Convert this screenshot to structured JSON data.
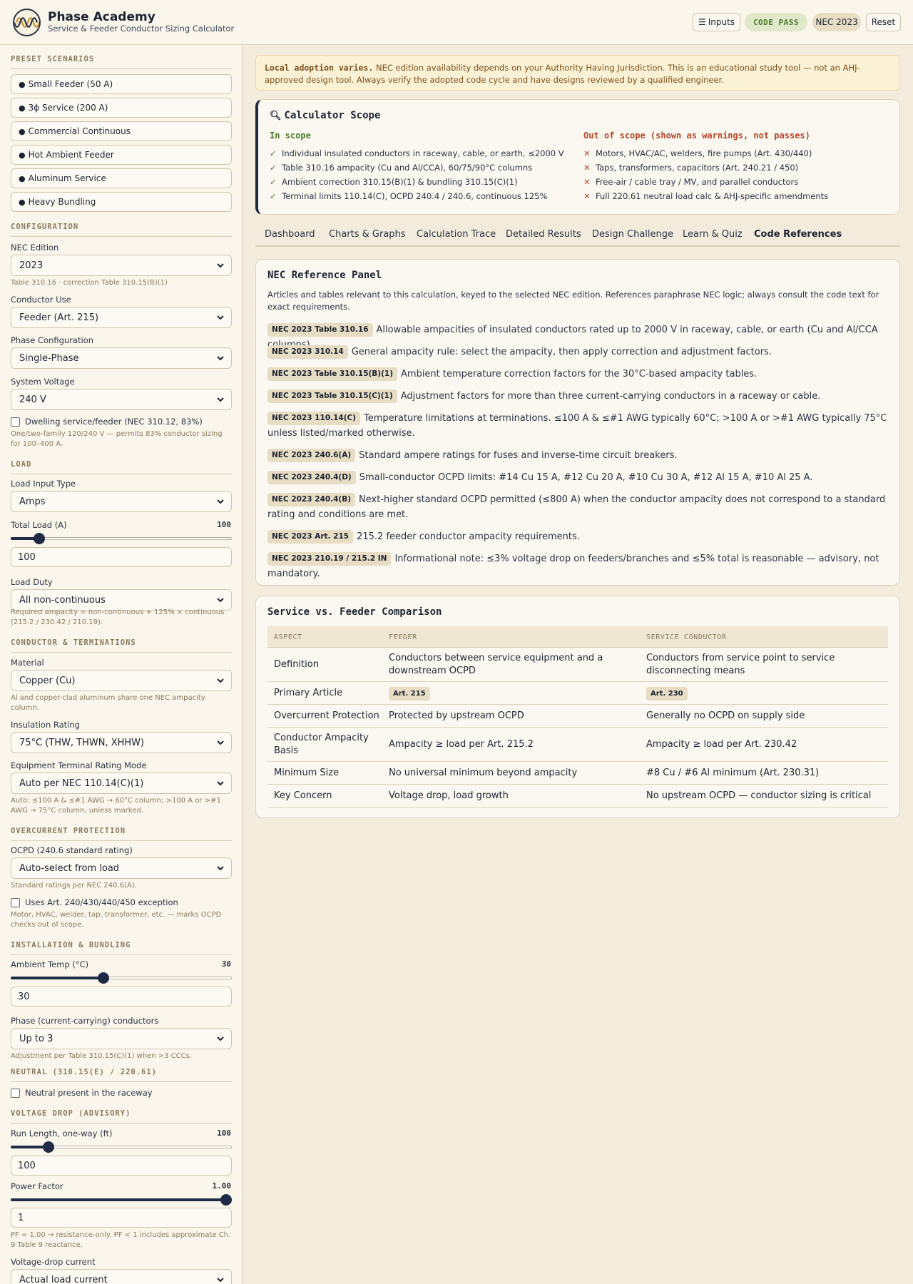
{
  "header": {
    "brand_title": "Phase Academy",
    "brand_subtitle": "Service & Feeder Conductor Sizing Calculator",
    "inputs_button": "Inputs",
    "status_pill": "CODE PASS",
    "edition_pill": "NEC 2023",
    "reset_button": "Reset"
  },
  "sidebar": {
    "presets_title": "PRESET SCENARIOS",
    "presets": [
      "Small Feeder (50 A)",
      "3ϕ Service (200 A)",
      "Commercial Continuous",
      "Hot Ambient Feeder",
      "Aluminum Service",
      "Heavy Bundling"
    ],
    "configuration": {
      "title": "CONFIGURATION",
      "nec_edition_label": "NEC Edition",
      "nec_edition_value": "2023",
      "nec_edition_hint": "Table 310.16 · correction Table 310.15(B)(1)",
      "conductor_use_label": "Conductor Use",
      "conductor_use_value": "Feeder (Art. 215)",
      "phase_label": "Phase Configuration",
      "phase_value": "Single-Phase",
      "voltage_label": "System Voltage",
      "voltage_value": "240 V",
      "dwelling_label": "Dwelling service/feeder (NEC 310.12, 83%)",
      "dwelling_checked": false,
      "dwelling_hint": "One/two-family 120/240 V — permits 83% conductor sizing for 100–400 A."
    },
    "load": {
      "title": "LOAD",
      "input_type_label": "Load Input Type",
      "input_type_value": "Amps",
      "total_label": "Total Load (A)",
      "total_value": "100",
      "total_fraction": 0.13,
      "duty_label": "Load Duty",
      "duty_value": "All non-continuous",
      "duty_hint": "Required ampacity = non-continuous + 125% × continuous (215.2 / 230.42 / 210.19)."
    },
    "conductor": {
      "title": "CONDUCTOR & TERMINATIONS",
      "material_label": "Material",
      "material_value": "Copper (Cu)",
      "material_hint": "Al and copper-clad aluminum share one NEC ampacity column.",
      "insulation_label": "Insulation Rating",
      "insulation_value": "75°C (THW, THWN, XHHW)",
      "terminal_label": "Equipment Terminal Rating Mode",
      "terminal_value": "Auto per NEC 110.14(C)(1)",
      "terminal_hint": "Auto: ≤100 A & ≤#1 AWG → 60°C column; >100 A or >#1 AWG → 75°C column, unless marked."
    },
    "ocpd": {
      "title": "OVERCURRENT PROTECTION",
      "label": "OCPD (240.6 standard rating)",
      "value": "Auto-select from load",
      "hint": "Standard ratings per NEC 240.6(A).",
      "exception_label": "Uses Art. 240/430/440/450 exception",
      "exception_checked": false,
      "exception_hint": "Motor, HVAC, welder, tap, transformer, etc. — marks OCPD checks out of scope."
    },
    "install": {
      "title": "INSTALLATION & BUNDLING",
      "ambient_label": "Ambient Temp (°C)",
      "ambient_value": "30",
      "ambient_fraction": 0.42,
      "ccc_label": "Phase (current-carrying) conductors",
      "ccc_value": "Up to 3",
      "ccc_hint": "Adjustment per Table 310.15(C)(1) when >3 CCCs."
    },
    "neutral": {
      "title": "NEUTRAL (310.15(E) / 220.61)",
      "label": "Neutral present in the raceway",
      "checked": false
    },
    "vd": {
      "title": "VOLTAGE DROP (ADVISORY)",
      "run_label": "Run Length, one-way (ft)",
      "run_value": "100",
      "run_fraction": 0.17,
      "pf_label": "Power Factor",
      "pf_value": "1.00",
      "pf_input": "1",
      "pf_fraction": 1.0,
      "pf_hint": "PF = 1.00 → resistance-only. PF < 1 includes approximate Ch. 9 Table 9 reactance.",
      "current_label": "Voltage-drop current",
      "current_value": "Actual load current"
    }
  },
  "banner": {
    "strong": "Local adoption varies.",
    "text": "NEC edition availability depends on your Authority Having Jurisdiction. This is an educational study tool — not an AHJ-approved design tool. Always verify the adopted code cycle and have designs reviewed by a qualified engineer."
  },
  "scope": {
    "title": "Calculator Scope",
    "in_title": "In scope",
    "in_items": [
      "Individual insulated conductors in raceway, cable, or earth, ≤2000 V",
      "Table 310.16 ampacity (Cu and Al/CCA), 60/75/90°C columns",
      "Ambient correction 310.15(B)(1) & bundling 310.15(C)(1)",
      "Terminal limits 110.14(C), OCPD 240.4 / 240.6, continuous 125%"
    ],
    "out_title": "Out of scope (shown as warnings, not passes)",
    "out_items": [
      "Motors, HVAC/AC, welders, fire pumps (Art. 430/440)",
      "Taps, transformers, capacitors (Art. 240.21 / 450)",
      "Free-air / cable tray / MV, and parallel conductors",
      "Full 220.61 neutral load calc & AHJ-specific amendments"
    ]
  },
  "tabs": [
    "Dashboard",
    "Charts & Graphs",
    "Calculation Trace",
    "Detailed Results",
    "Design Challenge",
    "Learn & Quiz",
    "Code References"
  ],
  "active_tab": "Code References",
  "reference": {
    "title": "NEC Reference Panel",
    "description": "Articles and tables relevant to this calculation, keyed to the selected NEC edition. References paraphrase NEC logic; always consult the code text for exact requirements.",
    "items": [
      {
        "tag": "NEC 2023 Table 310.16",
        "text": "Allowable ampacities of insulated conductors rated up to 2000 V in raceway, cable, or earth (Cu and Al/CCA columns)."
      },
      {
        "tag": "NEC 2023 310.14",
        "text": "General ampacity rule: select the ampacity, then apply correction and adjustment factors."
      },
      {
        "tag": "NEC 2023 Table 310.15(B)(1)",
        "text": "Ambient temperature correction factors for the 30°C-based ampacity tables."
      },
      {
        "tag": "NEC 2023 Table 310.15(C)(1)",
        "text": "Adjustment factors for more than three current-carrying conductors in a raceway or cable."
      },
      {
        "tag": "NEC 2023 110.14(C)",
        "text": "Temperature limitations at terminations. ≤100 A & ≤#1 AWG typically 60°C; >100 A or >#1 AWG typically 75°C unless listed/marked otherwise."
      },
      {
        "tag": "NEC 2023 240.6(A)",
        "text": "Standard ampere ratings for fuses and inverse-time circuit breakers."
      },
      {
        "tag": "NEC 2023 240.4(D)",
        "text": "Small-conductor OCPD limits: #14 Cu 15 A, #12 Cu 20 A, #10 Cu 30 A, #12 Al 15 A, #10 Al 25 A."
      },
      {
        "tag": "NEC 2023 240.4(B)",
        "text": "Next-higher standard OCPD permitted (≤800 A) when the conductor ampacity does not correspond to a standard rating and conditions are met."
      },
      {
        "tag": "NEC 2023 Art. 215",
        "text": "215.2 feeder conductor ampacity requirements."
      },
      {
        "tag": "NEC 2023 210.19 / 215.2 IN",
        "text": "Informational note: ≤3% voltage drop on feeders/branches and ≤5% total is reasonable — advisory, not mandatory."
      }
    ]
  },
  "comparison": {
    "title": "Service vs. Feeder Comparison",
    "headers": [
      "ASPECT",
      "FEEDER",
      "SERVICE CONDUCTOR"
    ],
    "rows": [
      {
        "aspect": "Definition",
        "feeder": "Conductors between service equipment and a downstream OCPD",
        "service": "Conductors from service point to service disconnecting means"
      },
      {
        "aspect": "Primary Article",
        "feeder": "Art. 215",
        "service": "Art. 230"
      },
      {
        "aspect": "Overcurrent Protection",
        "feeder": "Protected by upstream OCPD",
        "service": "Generally no OCPD on supply side"
      },
      {
        "aspect": "Conductor Ampacity Basis",
        "feeder": "Ampacity ≥ load per Art. 215.2",
        "service": "Ampacity ≥ load per Art. 230.42"
      },
      {
        "aspect": "Minimum Size",
        "feeder": "No universal minimum beyond ampacity",
        "service": "#8 Cu / #6 Al minimum (Art. 230.31)"
      },
      {
        "aspect": "Key Concern",
        "feeder": "Voltage drop, load growth",
        "service": "No upstream OCPD — conductor sizing is critical"
      }
    ]
  }
}
